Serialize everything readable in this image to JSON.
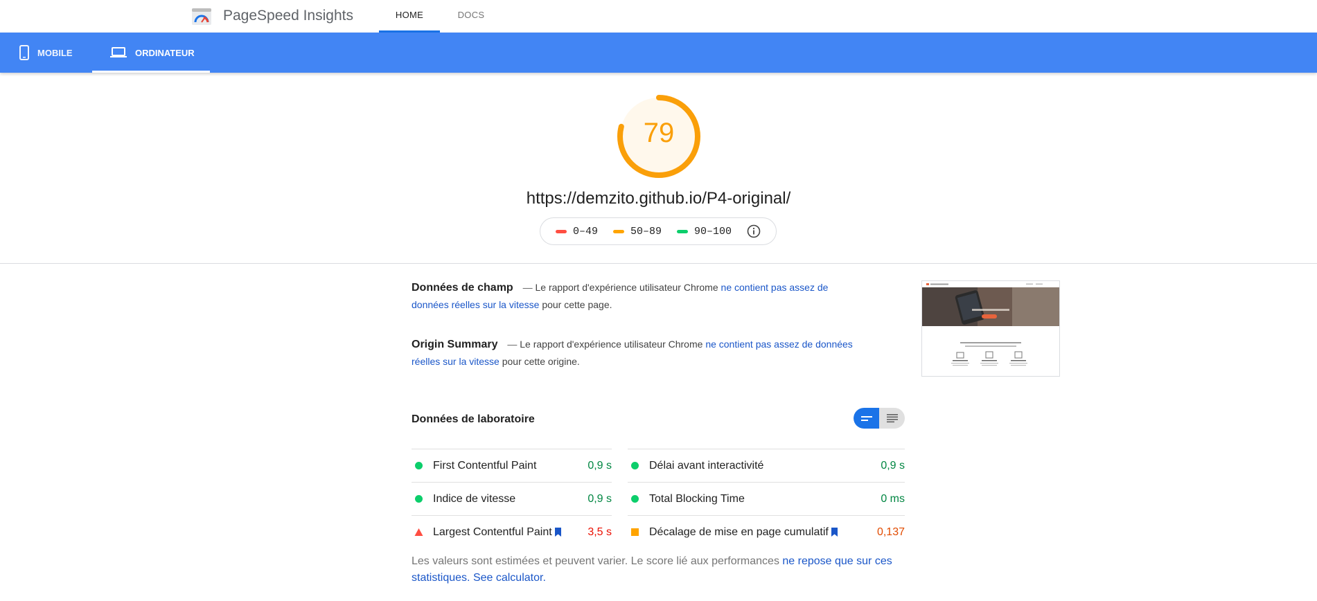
{
  "header": {
    "brand": "PageSpeed Insights",
    "nav": [
      {
        "label": "HOME"
      },
      {
        "label": "DOCS"
      }
    ]
  },
  "device_tabs": [
    {
      "label": "MOBILE"
    },
    {
      "label": "ORDINATEUR"
    }
  ],
  "score": {
    "value": "79",
    "fraction": 0.79,
    "color": "#fa9f09",
    "url": "https://demzito.github.io/P4-original/"
  },
  "legend": [
    {
      "label": "0–49",
      "color": "#ff4e42"
    },
    {
      "label": "50–89",
      "color": "#ffa400"
    },
    {
      "label": "90–100",
      "color": "#0cce6b"
    }
  ],
  "field_data": {
    "title": "Données de champ",
    "dash": "—",
    "text_before": "Le rapport d'expérience utilisateur Chrome",
    "link": "ne contient pas assez de données réelles sur la vitesse",
    "text_after": "pour cette page."
  },
  "origin_summary": {
    "title": "Origin Summary",
    "dash": "—",
    "text_before": "Le rapport d'expérience utilisateur Chrome",
    "link": "ne contient pas assez de données réelles sur la vitesse",
    "text_after": "pour cette origine."
  },
  "lab": {
    "title": "Données de laboratoire",
    "metrics_left": [
      {
        "label": "First Contentful Paint",
        "value": "0,9 s",
        "status": "good"
      },
      {
        "label": "Indice de vitesse",
        "value": "0,9 s",
        "status": "good"
      },
      {
        "label": "Largest Contentful Paint",
        "value": "3,5 s",
        "status": "bad"
      }
    ],
    "metrics_right": [
      {
        "label": "Délai avant interactivité",
        "value": "0,9 s",
        "status": "good"
      },
      {
        "label": "Total Blocking Time",
        "value": "0 ms",
        "status": "good"
      },
      {
        "label": "Décalage de mise en page cumulatif",
        "value": "0,137",
        "status": "average"
      }
    ]
  },
  "note": {
    "text": "Les valeurs sont estimées et peuvent varier. Le score lié aux performances",
    "link": "ne repose que sur ces statistiques.",
    "calculator": "See calculator."
  },
  "colors": {
    "accent": "#4285f4",
    "good": "#0cce6b",
    "average": "#ffa400",
    "bad": "#ff4e42"
  }
}
